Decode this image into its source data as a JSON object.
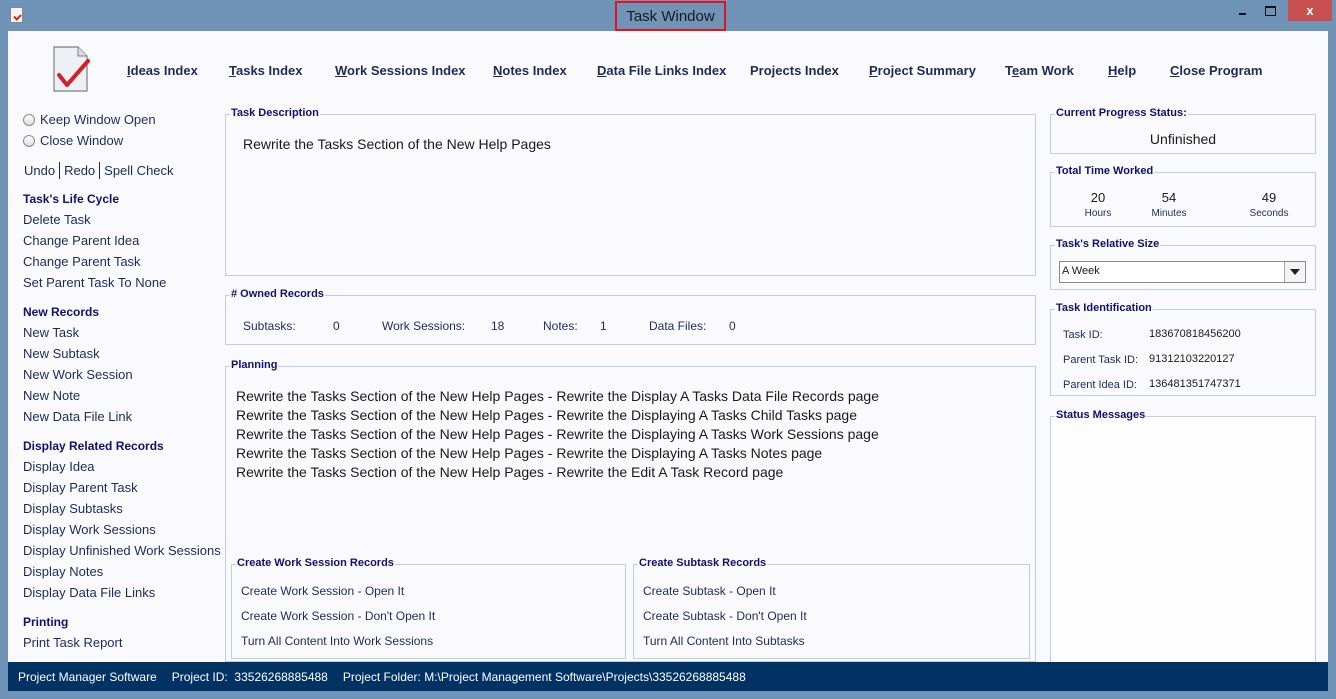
{
  "window": {
    "title": "Task Window",
    "controls": {
      "minimize": "minimize",
      "maximize": "maximize",
      "close": "x"
    }
  },
  "topnav": [
    {
      "label": "Ideas Index",
      "mnemonic": "I"
    },
    {
      "label": "Tasks Index",
      "mnemonic": "T"
    },
    {
      "label": "Work Sessions Index",
      "mnemonic": "W"
    },
    {
      "label": "Notes Index",
      "mnemonic": "N"
    },
    {
      "label": "Data File Links Index",
      "mnemonic": "D"
    },
    {
      "label": "Projects Index",
      "mnemonic": ""
    },
    {
      "label": "Project Summary",
      "mnemonic": "P"
    },
    {
      "label": "Team Work",
      "mnemonic": "e"
    },
    {
      "label": "Help",
      "mnemonic": "H"
    },
    {
      "label": "Close Program",
      "mnemonic": "C"
    }
  ],
  "sidebar": {
    "radios": [
      {
        "label": "Keep Window Open",
        "selected": false
      },
      {
        "label": "Close Window",
        "selected": false
      }
    ],
    "edit": [
      "Undo",
      "Redo",
      "Spell Check"
    ],
    "sections": [
      {
        "title": "Task's Life Cycle",
        "items": [
          "Delete Task",
          "Change Parent Idea",
          "Change Parent Task",
          "Set Parent Task To None"
        ]
      },
      {
        "title": "New Records",
        "items": [
          "New Task",
          "New Subtask",
          "New Work Session",
          "New Note",
          "New Data File Link"
        ]
      },
      {
        "title": "Display Related Records",
        "items": [
          "Display Idea",
          "Display Parent Task",
          "Display Subtasks",
          "Display Work Sessions",
          "Display Unfinished Work Sessions",
          "Display Notes",
          "Display Data File Links"
        ]
      },
      {
        "title": "Printing",
        "items": [
          "Print Task Report"
        ]
      }
    ]
  },
  "task_description": {
    "label": "Task Description",
    "text": "Rewrite the Tasks Section of the New Help Pages"
  },
  "owned_records": {
    "label": "# Owned Records",
    "subtasks_label": "Subtasks:",
    "subtasks": "0",
    "work_sessions_label": "Work Sessions:",
    "work_sessions": "18",
    "notes_label": "Notes:",
    "notes": "1",
    "data_files_label": "Data Files:",
    "data_files": "0"
  },
  "planning": {
    "label": "Planning",
    "lines": [
      "Rewrite the Tasks Section of the New Help Pages - Rewrite the Display A Tasks Data File Records page",
      "Rewrite the Tasks Section of the New Help Pages - Rewrite the Displaying A Tasks Child Tasks page",
      "Rewrite the Tasks Section of the New Help Pages - Rewrite the Displaying A Tasks Work Sessions page",
      "Rewrite the Tasks Section of the New Help Pages - Rewrite the Displaying A Tasks Notes page",
      "Rewrite the Tasks Section of the New Help Pages - Rewrite the Edit A Task Record page"
    ]
  },
  "create_work_sessions": {
    "label": "Create Work Session Records",
    "actions": [
      "Create Work Session - Open It",
      "Create Work Session - Don't Open It",
      "Turn All Content Into Work Sessions"
    ]
  },
  "create_subtasks": {
    "label": "Create Subtask Records",
    "actions": [
      "Create Subtask - Open It",
      "Create Subtask - Don't Open It",
      "Turn All Content Into Subtasks"
    ]
  },
  "progress": {
    "label": "Current Progress Status:",
    "value": "Unfinished"
  },
  "time_worked": {
    "label": "Total Time Worked",
    "hours": "20",
    "hours_label": "Hours",
    "minutes": "54",
    "minutes_label": "Minutes",
    "seconds": "49",
    "seconds_label": "Seconds"
  },
  "relative_size": {
    "label": "Task's Relative Size",
    "selected": "A Week"
  },
  "identification": {
    "label": "Task Identification",
    "task_id_label": "Task ID:",
    "task_id": "183670818456200",
    "parent_task_label": "Parent Task ID:",
    "parent_task_id": "91312103220127",
    "parent_idea_label": "Parent Idea ID:",
    "parent_idea_id": "136481351747371"
  },
  "status_messages": {
    "label": "Status Messages"
  },
  "statusbar": {
    "app": "Project Manager Software",
    "project_id": "Project ID:  33526268885488",
    "project_folder": "Project Folder: M:\\Project Management Software\\Projects\\33526268885488"
  },
  "colors": {
    "titlebar": "#6f94b8",
    "statusbar": "#003264",
    "close_button": "#c75050",
    "heading": "#10106e",
    "highlight": "#e0141e"
  }
}
